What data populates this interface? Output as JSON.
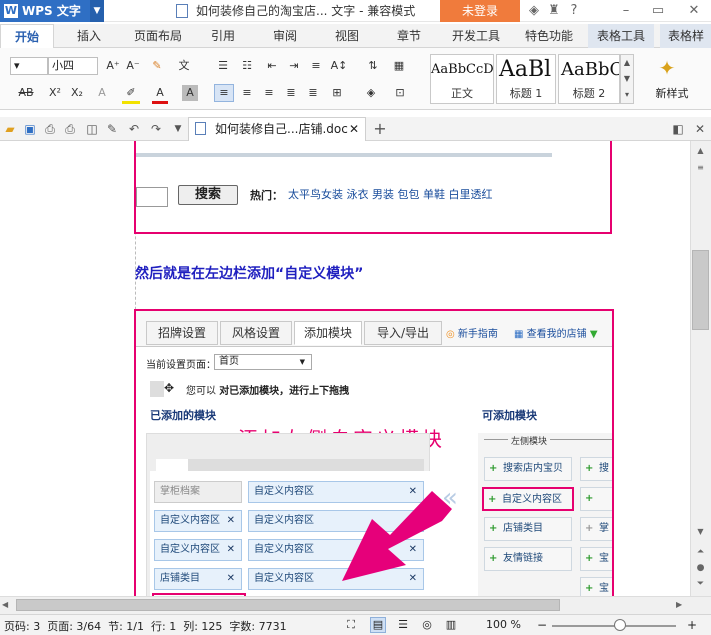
{
  "app": {
    "name": "WPS 文字",
    "logo": "W"
  },
  "title": "如何装修自己的淘宝店... 文字 - 兼容模式",
  "login_button": "未登录",
  "tabs": [
    "开始",
    "插入",
    "页面布局",
    "引用",
    "审阅",
    "视图",
    "章节",
    "开发工具",
    "特色功能",
    "表格工具",
    "表格样"
  ],
  "ribbon": {
    "font_size": "小四",
    "styles": [
      {
        "sample": "AaBbCcD",
        "name": "正文"
      },
      {
        "sample": "AaBl",
        "name": "标题 1"
      },
      {
        "sample": "AaBbC",
        "name": "标题 2"
      }
    ],
    "new_style": "新样式"
  },
  "doc_tab": {
    "name": "如何装修自己...店铺.doc"
  },
  "document": {
    "search_button": "搜索",
    "hot_label": "热门：",
    "hot_links": "太平鸟女装 泳衣 男装 包包 单鞋 白里透红",
    "heading": "然后就是在左边栏添加“自定义模块”",
    "inner_tabs": [
      "招牌设置",
      "风格设置",
      "添加模块",
      "导入/导出"
    ],
    "guide_link": "新手指南",
    "view_shop_link": "查看我的店铺",
    "current_page_label": "当前设置页面：",
    "current_page_value": "首页",
    "drag_hint_prefix": "您可以",
    "drag_hint_bold": "对已添加模块，进行上下拖拽",
    "added_modules_title": "已添加的模块",
    "available_modules_title": "可添加模块",
    "overlay_text": "添加左侧自定义模块",
    "left_group": "左侧模块",
    "added_modules_left": [
      "掌柜档案",
      "自定义内容区",
      "自定义内容区",
      "店铺类目"
    ],
    "added_modules_right": [
      "自定义内容区",
      "自定义内容区",
      "自定义内容区",
      "自定义内容区"
    ],
    "available_modules": [
      "搜索店内宝贝",
      "自定义内容区",
      "店铺类目",
      "友情链接"
    ],
    "available_modules_cut": [
      "搜",
      "",
      "掌",
      "宝",
      "宝"
    ]
  },
  "status": {
    "page_num": "页码: 3",
    "page": "页面: 3/64",
    "section": "节: 1/1",
    "row": "行: 1",
    "col": "列: 125",
    "words": "字数: 7731",
    "zoom": "100 %",
    "zoom_level": 0.55
  },
  "colors": {
    "accent": "#2f6fc4",
    "login": "#f07b3c",
    "pink": "#e6006f"
  }
}
